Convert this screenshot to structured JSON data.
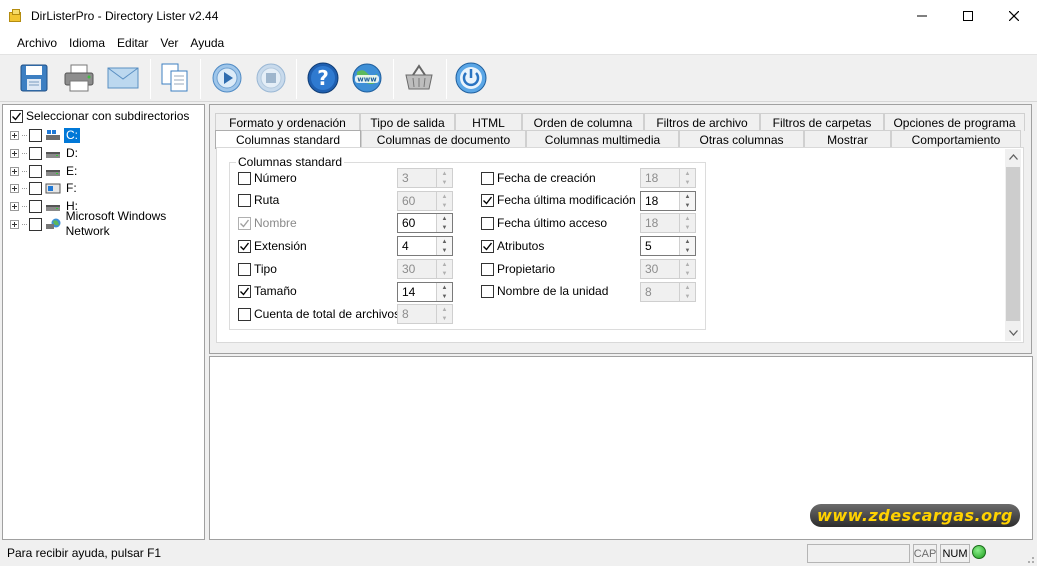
{
  "window": {
    "title": "DirListerPro - Directory Lister  v2.44"
  },
  "menu": [
    "Archivo",
    "Idioma",
    "Editar",
    "Ver",
    "Ayuda"
  ],
  "tree": {
    "select_subdirs_label": "Seleccionar con subdirectorios",
    "select_subdirs_checked": true,
    "items": [
      {
        "label": "C:",
        "selected": true,
        "icon": "windows-drive-icon"
      },
      {
        "label": "D:",
        "selected": false,
        "icon": "hard-drive-icon"
      },
      {
        "label": "E:",
        "selected": false,
        "icon": "hard-drive-icon"
      },
      {
        "label": "F:",
        "selected": false,
        "icon": "removable-drive-icon"
      },
      {
        "label": "H:",
        "selected": false,
        "icon": "hard-drive-icon"
      },
      {
        "label": "Microsoft Windows Network",
        "selected": false,
        "icon": "network-icon"
      }
    ]
  },
  "tabs": {
    "row1": [
      "Formato y ordenación",
      "Tipo de salida",
      "HTML",
      "Orden de columna",
      "Filtros de archivo",
      "Filtros de carpetas",
      "Opciones de programa"
    ],
    "row2": [
      "Columnas standard",
      "Columnas de documento",
      "Columnas multimedia",
      "Otras columnas",
      "Mostrar",
      "Comportamiento"
    ],
    "active": "Columnas standard"
  },
  "group": {
    "title": "Columnas standard",
    "left_fields": [
      {
        "label": "Número",
        "checked": false,
        "enabled": true,
        "value": "3",
        "spin_enabled": false
      },
      {
        "label": "Ruta",
        "checked": false,
        "enabled": true,
        "value": "60",
        "spin_enabled": false
      },
      {
        "label": "Nombre",
        "checked": true,
        "enabled": false,
        "value": "60",
        "spin_enabled": true
      },
      {
        "label": "Extensión",
        "checked": true,
        "enabled": true,
        "value": "4",
        "spin_enabled": true
      },
      {
        "label": "Tipo",
        "checked": false,
        "enabled": true,
        "value": "30",
        "spin_enabled": false
      },
      {
        "label": "Tamaño",
        "checked": true,
        "enabled": true,
        "value": "14",
        "spin_enabled": true
      },
      {
        "label": "Cuenta de total de archivos",
        "checked": false,
        "enabled": true,
        "value": "8",
        "spin_enabled": false
      }
    ],
    "right_fields": [
      {
        "label": "Fecha de creación",
        "checked": false,
        "enabled": true,
        "value": "18",
        "spin_enabled": false
      },
      {
        "label": "Fecha última modificación",
        "checked": true,
        "enabled": true,
        "value": "18",
        "spin_enabled": true
      },
      {
        "label": "Fecha último acceso",
        "checked": false,
        "enabled": true,
        "value": "18",
        "spin_enabled": false
      },
      {
        "label": "Atributos",
        "checked": true,
        "enabled": true,
        "value": "5",
        "spin_enabled": true
      },
      {
        "label": "Propietario",
        "checked": false,
        "enabled": true,
        "value": "30",
        "spin_enabled": false
      },
      {
        "label": "Nombre de la unidad",
        "checked": false,
        "enabled": true,
        "value": "8",
        "spin_enabled": false
      }
    ]
  },
  "watermark": "www.zdescargas.org",
  "status": {
    "text": "Para recibir ayuda, pulsar F1",
    "cap": "CAP",
    "num": "NUM",
    "led_color": "#22aa22"
  }
}
